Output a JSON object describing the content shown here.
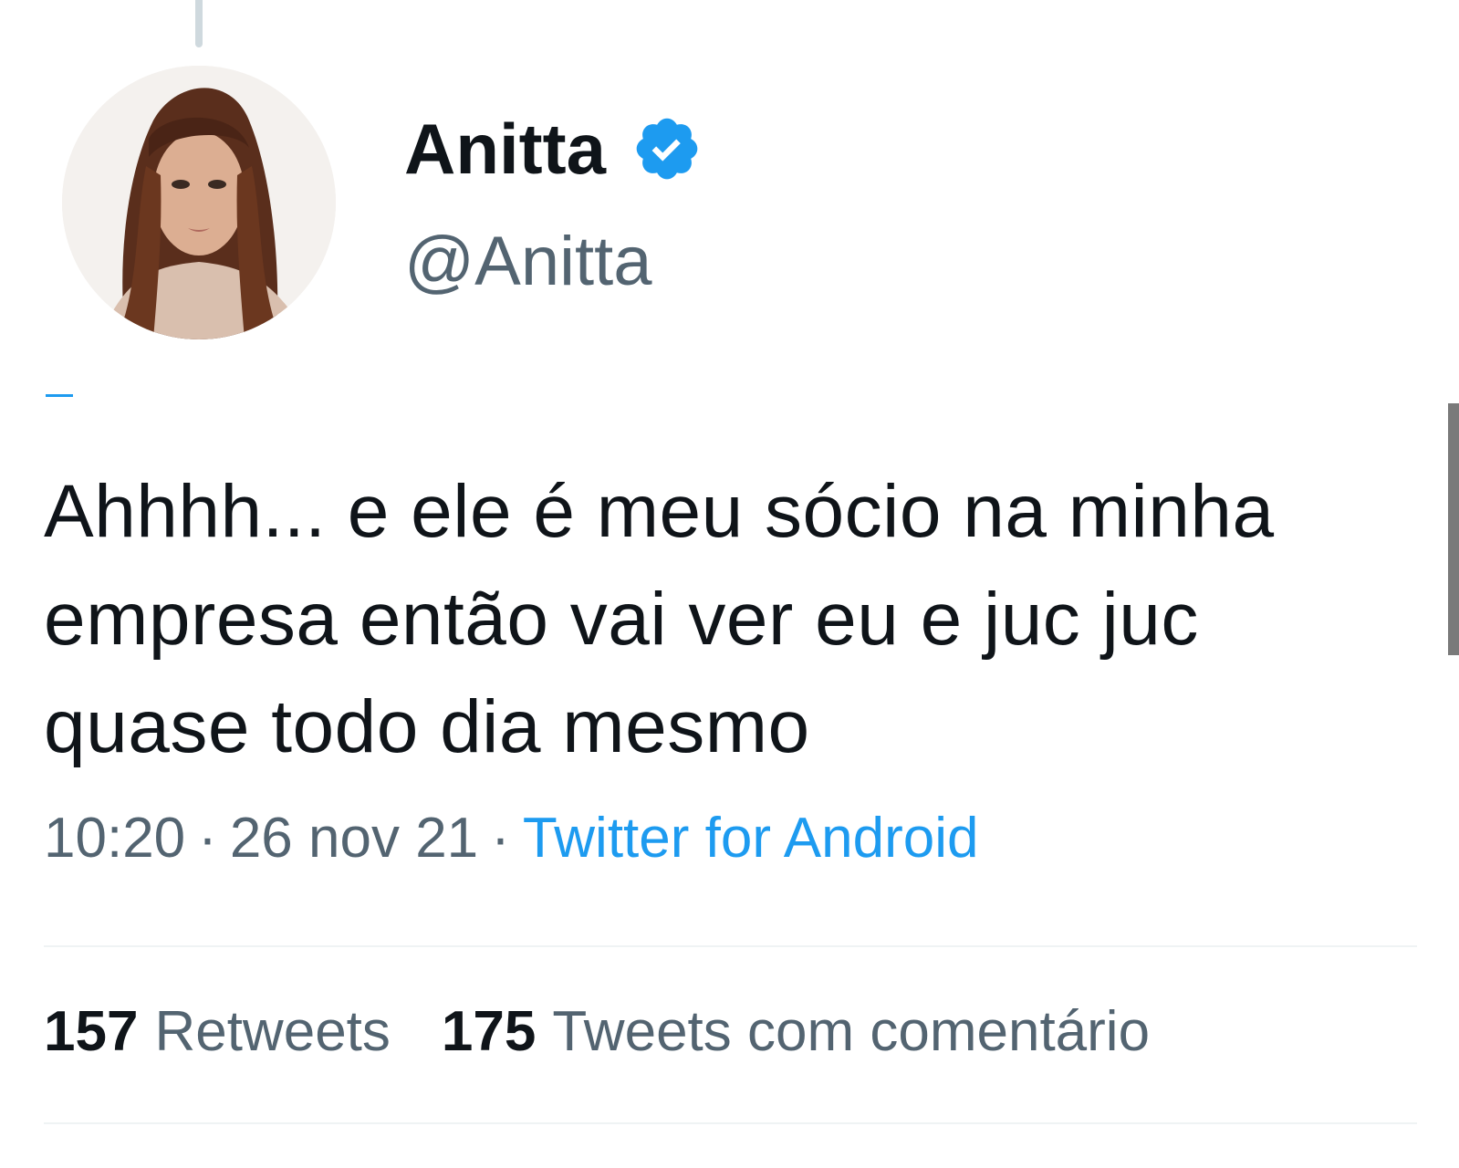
{
  "tweet": {
    "display_name": "Anitta",
    "handle": "@Anitta",
    "verified": true,
    "text": "Ahhhh... e ele é meu sócio na minha empresa então vai ver eu e juc juc quase todo dia mesmo",
    "time": "10:20",
    "date": "26 nov 21",
    "source": "Twitter for Android",
    "separator": "·"
  },
  "stats": {
    "retweets_count": "157",
    "retweets_label": "Retweets",
    "quotes_count": "175",
    "quotes_label": "Tweets com comentário"
  },
  "icons": {
    "avatar": "profile-photo",
    "verified": "verified-badge-icon"
  },
  "colors": {
    "text_primary": "#0f1419",
    "text_secondary": "#536471",
    "accent": "#1d9bf0",
    "divider": "#eff3f4"
  }
}
